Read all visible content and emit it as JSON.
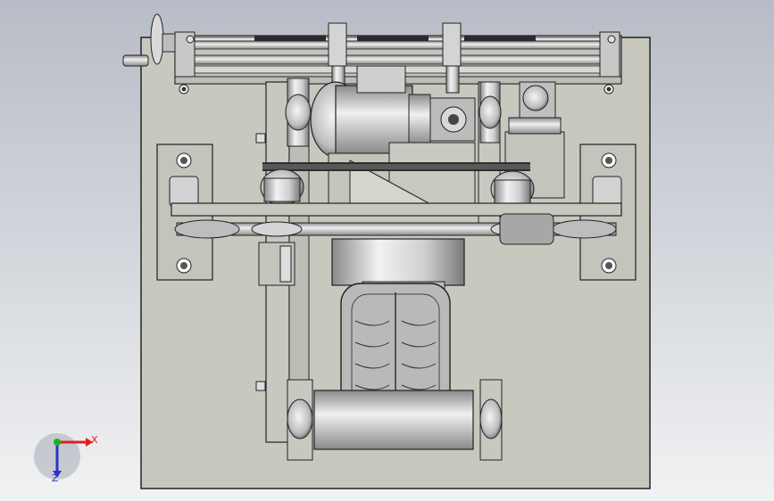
{
  "viewport": {
    "background_top": "#b7bcc6",
    "background_bottom": "#f1f2f3"
  },
  "model": {
    "plate_color": "#c9c8bf",
    "metal_color": "#c5c5c5",
    "outline_color": "#222222",
    "tread_color": "#b9b9b9"
  },
  "triad": {
    "x_label": "X",
    "y_label": "Z",
    "x_color": "#e02020",
    "y_color": "#2a34c8",
    "z_color": "#20b020"
  }
}
